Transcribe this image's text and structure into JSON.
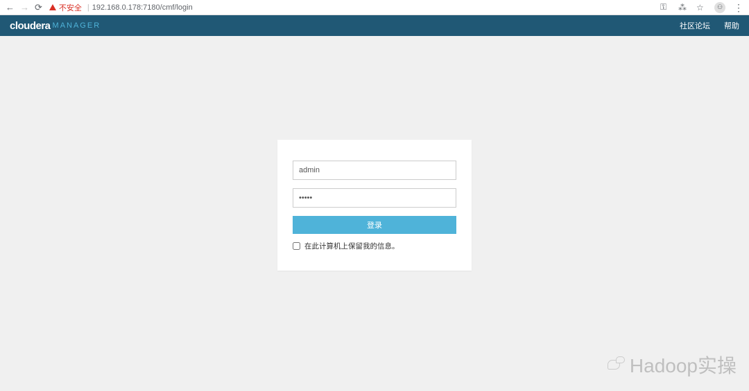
{
  "browser": {
    "insecure_label": "不安全",
    "url": "192.168.0.178:7180/cmf/login"
  },
  "header": {
    "logo_main": "cloudera",
    "logo_sub": "MANAGER",
    "links": {
      "community": "社区论坛",
      "help": "帮助"
    }
  },
  "login": {
    "username_value": "admin",
    "password_value": "•••••",
    "button_label": "登录",
    "remember_label": "在此计算机上保留我的信息。"
  },
  "watermark": {
    "text": "Hadoop实操"
  }
}
